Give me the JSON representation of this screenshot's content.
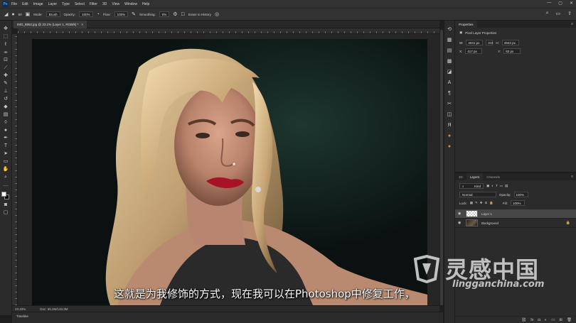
{
  "app": {
    "logo_text": "Ps",
    "menu": [
      "File",
      "Edit",
      "Image",
      "Layer",
      "Type",
      "Select",
      "Filter",
      "3D",
      "View",
      "Window",
      "Help"
    ],
    "window_controls": [
      "—",
      "▢",
      "✕"
    ]
  },
  "options_bar": {
    "brush_size": "50",
    "mode_label": "Mode:",
    "mode_value": "Brush",
    "opacity_label": "Opacity:",
    "opacity_value": "100%",
    "flow_label": "Flow:",
    "flow_value": "100%",
    "smoothing_label": "Smoothing:",
    "smoothing_value": "0%",
    "erase_to_history": "Erase to History"
  },
  "document": {
    "tab_title": "IMG_8852.jpg @ 23.1% (Layer 1, RGB/8) *",
    "tab_close": "×",
    "zoom": "23.33%",
    "doc_info": "Doc: 66.2M/133.3M"
  },
  "timeline": {
    "label": "Timeline"
  },
  "properties": {
    "tab": "Properties",
    "heading": "Pixel Layer Properties",
    "w_label": "W:",
    "w_value": "4041 px",
    "go_label": "GO",
    "h_label": "H:",
    "h_value": "3944 px",
    "x_label": "X:",
    "x_value": "417 px",
    "y_label": "Y:",
    "y_value": "82 px"
  },
  "layers_panel": {
    "tabs": [
      "3D",
      "Layers",
      "Channels"
    ],
    "active_tab": "Layers",
    "filter_kind": "Kind",
    "blend_mode": "Normal",
    "opacity_label": "Opacity:",
    "opacity_value": "100%",
    "lock_label": "Lock:",
    "fill_label": "Fill:",
    "fill_value": "100%",
    "layers": [
      {
        "name": "Layer 1",
        "selected": true
      },
      {
        "name": "Background",
        "selected": false,
        "locked": true
      }
    ]
  },
  "subtitle": "这就是为我修饰的方式，现在我可以在Photoshop中修复工作，",
  "watermark": {
    "name": "灵感中国",
    "url": "lingganchina.com"
  },
  "icons": {
    "toolbar": [
      "move-icon",
      "marquee-icon",
      "lasso-icon",
      "quick-select-icon",
      "crop-icon",
      "eyedropper-icon",
      "healing-icon",
      "brush-icon",
      "clone-stamp-icon",
      "history-brush-icon",
      "eraser-icon",
      "gradient-icon",
      "blur-icon",
      "dodge-icon",
      "pen-icon",
      "type-icon",
      "path-select-icon",
      "shape-icon",
      "hand-icon",
      "zoom-icon",
      "more-icon"
    ]
  },
  "colors": {
    "accent": "#31a8ff",
    "ui_bg": "#323232",
    "panel_bg": "#2b2b2b"
  }
}
